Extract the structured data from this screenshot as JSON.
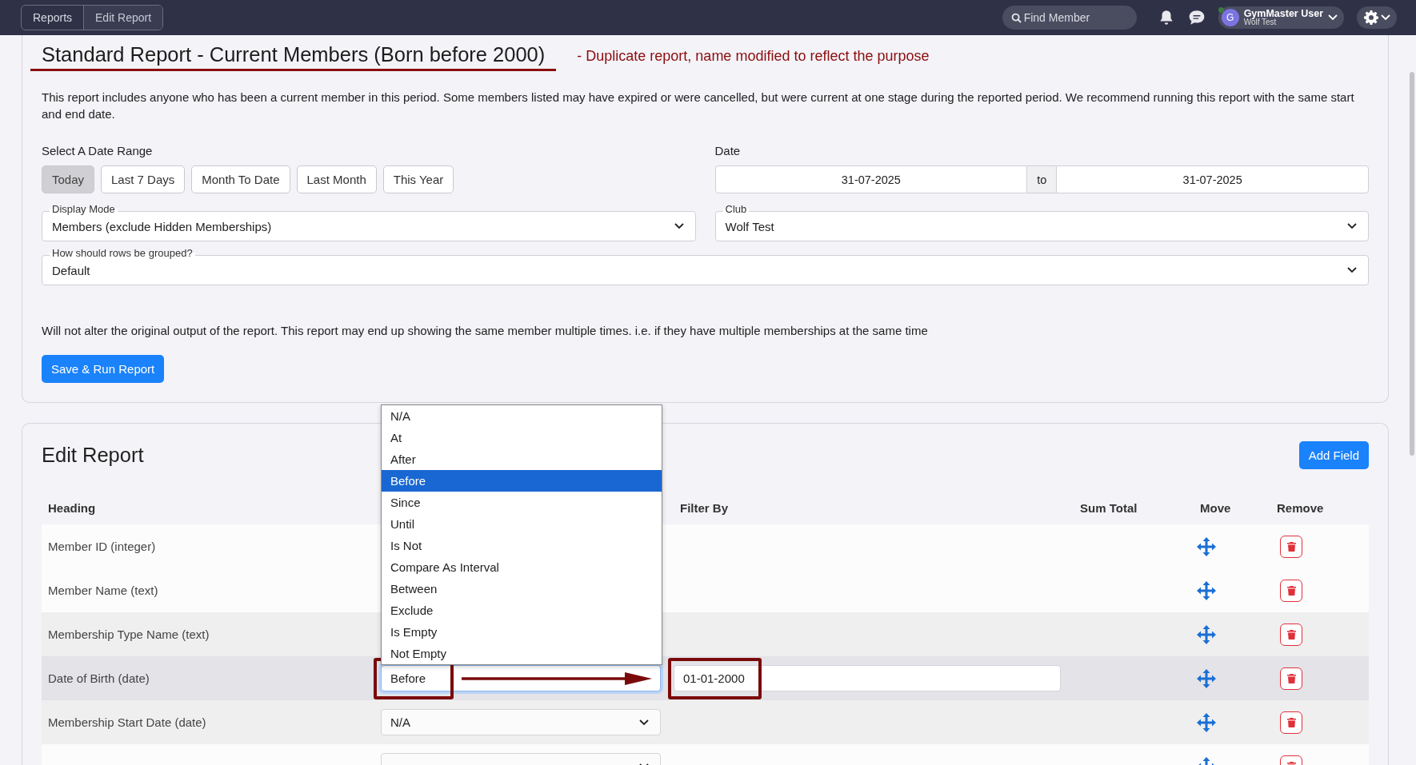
{
  "topbar": {
    "breadcrumbs": [
      {
        "label": "Reports",
        "current": false
      },
      {
        "label": "Edit Report",
        "current": true
      }
    ],
    "search": {
      "placeholder": "Find Member"
    },
    "user": {
      "avatar": "G",
      "name": "GymMaster User",
      "club": "Wolf Test",
      "online": true
    }
  },
  "report": {
    "title": "Standard Report - Current Members (Born before 2000)",
    "title_underlined": true,
    "annotation": "- Duplicate report, name modified to reflect the purpose",
    "description": "This report includes anyone who has been a current member in this period. Some members listed may have expired or were cancelled, but were current at one stage during the reported period. We recommend running this report with the same start and end date.",
    "date_range": {
      "label": "Select A Date Range",
      "buttons": [
        {
          "label": "Today",
          "selected": true
        },
        {
          "label": "Last 7 Days",
          "selected": false
        },
        {
          "label": "Month To Date",
          "selected": false
        },
        {
          "label": "Last Month",
          "selected": false
        },
        {
          "label": "This Year",
          "selected": false
        }
      ]
    },
    "date": {
      "label": "Date",
      "from": "31-07-2025",
      "separator": "to",
      "to": "31-07-2025"
    },
    "display_mode": {
      "label": "Display Mode",
      "value": "Members (exclude Hidden Memberships)"
    },
    "club": {
      "label": "Club",
      "value": "Wolf Test"
    },
    "grouping": {
      "label": "How should rows be grouped?",
      "value": "Default"
    },
    "note": "Will not alter the original output of the report. This report may end up showing the same member multiple times. i.e. if they have multiple memberships at the same time",
    "save_button": "Save & Run Report"
  },
  "edit_report": {
    "title": "Edit Report",
    "add_button": "Add Field",
    "columns": [
      "Heading",
      "Filter By",
      "Sum Total",
      "Move",
      "Remove"
    ],
    "rows": [
      {
        "heading": "Member ID (integer)",
        "shaded": false,
        "active": false
      },
      {
        "heading": "Member Name (text)",
        "shaded": false,
        "active": false
      },
      {
        "heading": "Membership Type Name (text)",
        "shaded": true,
        "active": false
      },
      {
        "heading": "Date of Birth (date)",
        "shaded": true,
        "active": true,
        "highlighted": true,
        "filter_type": {
          "value": "Before",
          "open": true,
          "options": [
            {
              "label": "N/A",
              "selected": false
            },
            {
              "label": "At",
              "selected": false
            },
            {
              "label": "After",
              "selected": false
            },
            {
              "label": "Before",
              "selected": true
            },
            {
              "label": "Since",
              "selected": false
            },
            {
              "label": "Until",
              "selected": false
            },
            {
              "label": "Is Not",
              "selected": false
            },
            {
              "label": "Compare As Interval",
              "selected": false
            },
            {
              "label": "Between",
              "selected": false
            },
            {
              "label": "Exclude",
              "selected": false
            },
            {
              "label": "Is Empty",
              "selected": false
            },
            {
              "label": "Not Empty",
              "selected": false
            }
          ]
        },
        "filter_value": "01-01-2000"
      },
      {
        "heading": "Membership Start Date (date)",
        "shaded": true,
        "active": false,
        "filter_type": {
          "value": "N/A",
          "open": false
        }
      },
      {
        "shaded": false,
        "active": false,
        "filter_type": {
          "open": false
        }
      }
    ]
  }
}
